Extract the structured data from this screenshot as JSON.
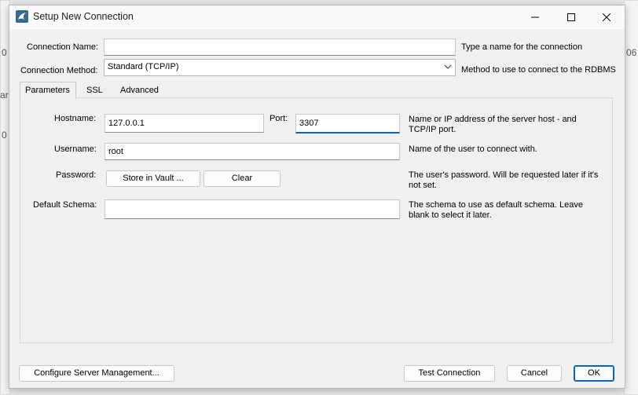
{
  "window": {
    "title": "Setup New Connection",
    "icon": "mysql-dolphin-icon"
  },
  "background": {
    "fragment_left_top": "0",
    "fragment_left_mid": "ar",
    "fragment_left_low": "0",
    "fragment_right": "06"
  },
  "form": {
    "connection_name": {
      "label": "Connection Name:",
      "value": "",
      "help": "Type a name for the connection"
    },
    "connection_method": {
      "label": "Connection Method:",
      "value": "Standard (TCP/IP)",
      "help": "Method to use to connect to the RDBMS"
    }
  },
  "tabs": [
    {
      "label": "Parameters",
      "active": true
    },
    {
      "label": "SSL",
      "active": false
    },
    {
      "label": "Advanced",
      "active": false
    }
  ],
  "parameters": {
    "hostname": {
      "label": "Hostname:",
      "value": "127.0.0.1"
    },
    "port": {
      "label": "Port:",
      "value": "3307"
    },
    "hostname_help_line1": "Name or IP address of the server host - and",
    "hostname_help_line2": "TCP/IP port.",
    "username": {
      "label": "Username:",
      "value": "root",
      "help": "Name of the user to connect with."
    },
    "password": {
      "label": "Password:",
      "store_button": "Store in Vault ...",
      "clear_button": "Clear",
      "help_line1": "The user's password. Will be requested later if it's",
      "help_line2": "not set."
    },
    "default_schema": {
      "label": "Default Schema:",
      "value": "",
      "help_line1": "The schema to use as default schema. Leave",
      "help_line2": "blank to select it later."
    }
  },
  "footer": {
    "configure_button": "Configure Server Management...",
    "test_button": "Test Connection",
    "cancel_button": "Cancel",
    "ok_button": "OK"
  },
  "colors": {
    "accent": "#0067c0",
    "dialog_bg": "#f0f0f0"
  }
}
